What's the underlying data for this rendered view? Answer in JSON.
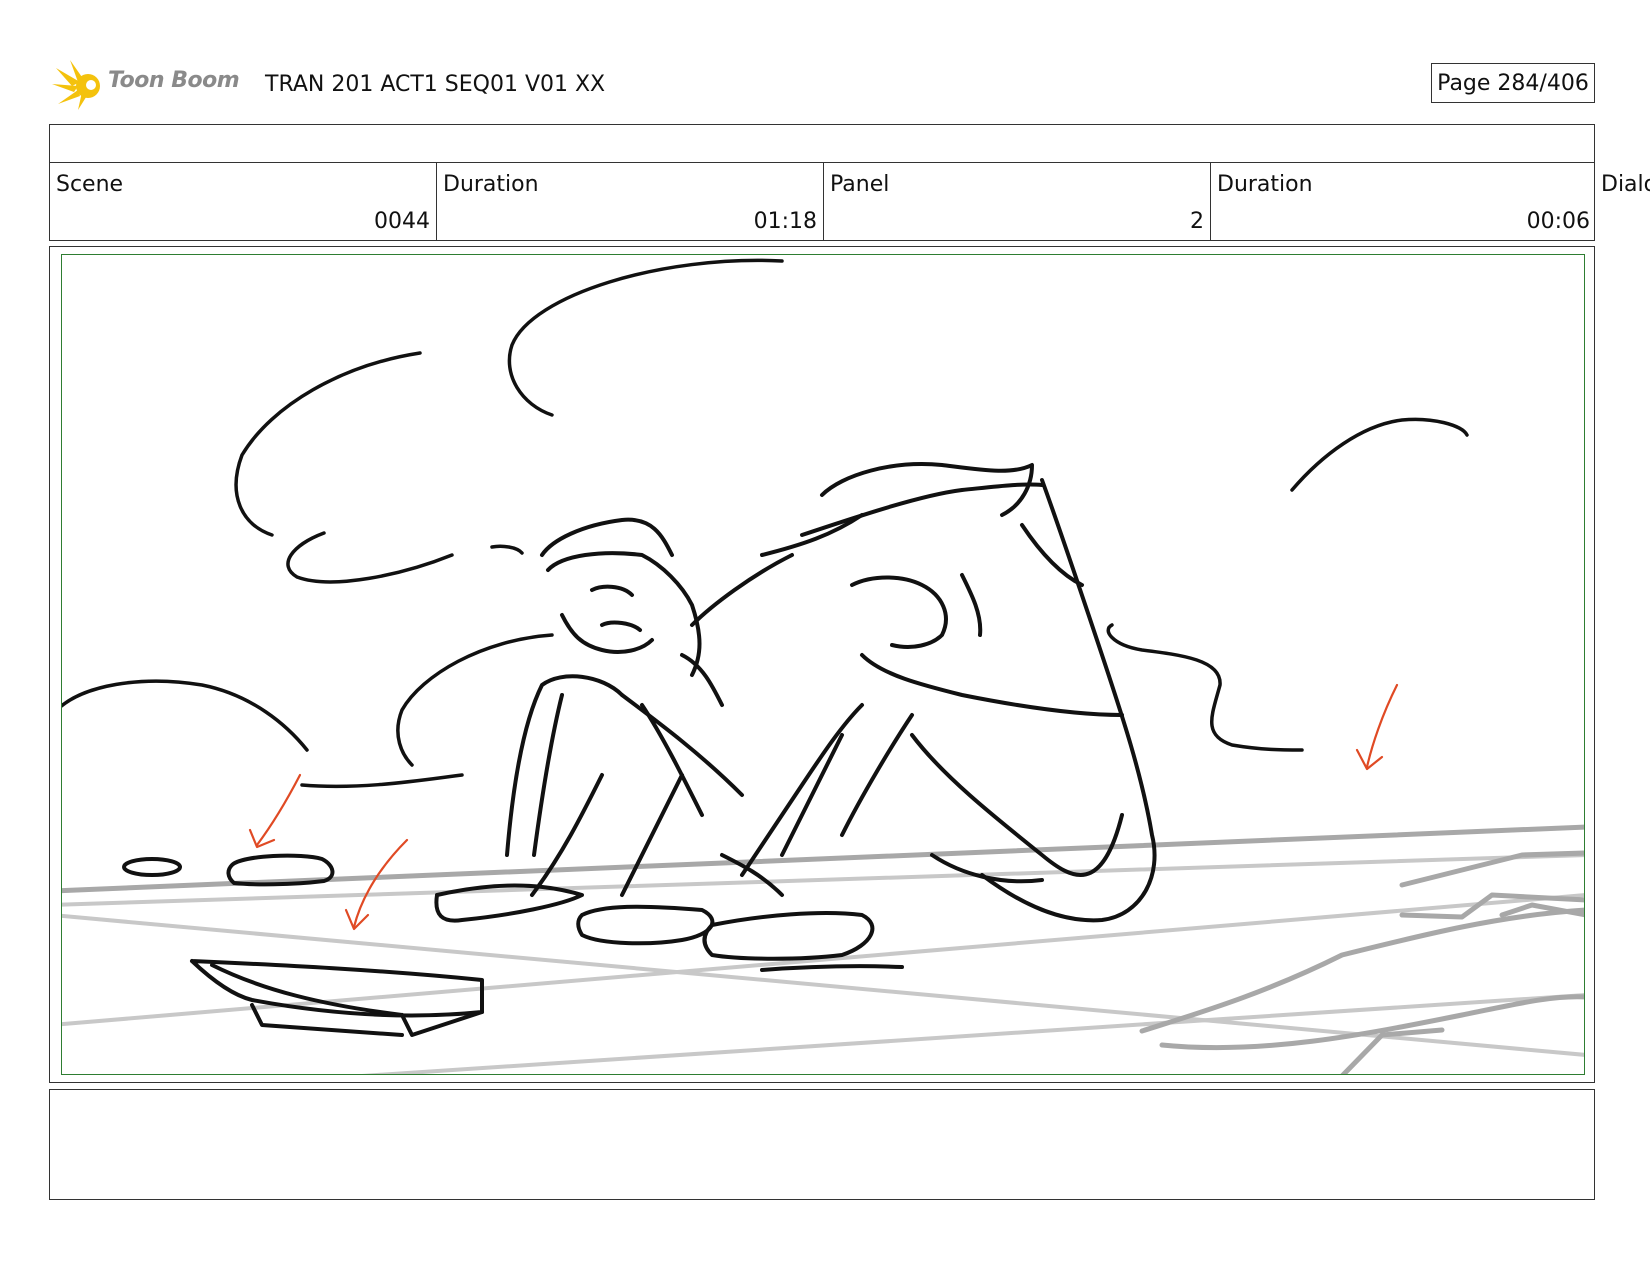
{
  "header": {
    "logo_text": "Toon Boom",
    "title": "TRAN 201 ACT1 SEQ01 V01 XX",
    "page": "Page 284/406"
  },
  "info": {
    "scene_label": "Scene",
    "scene_value": "0044",
    "scene_duration_label": "Duration",
    "scene_duration_value": "01:18",
    "panel_label": "Panel",
    "panel_value": "2",
    "panel_duration_label": "Duration",
    "panel_duration_value": "00:06",
    "dialog_label": "Dialo"
  },
  "colors": {
    "frame_border": "#2e7d32",
    "arrow": "#e04a24",
    "logo": "#f4c20d"
  },
  "icons": [
    "toon-boom-logo-icon",
    "camera-arrow-icon"
  ]
}
